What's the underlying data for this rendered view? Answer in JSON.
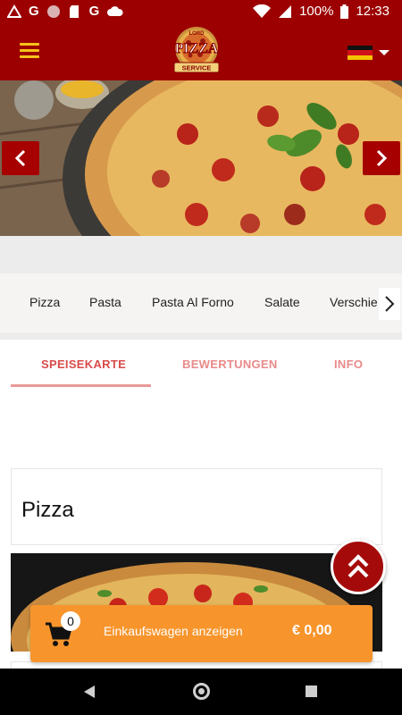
{
  "status_bar": {
    "left_glyphs": [
      "G",
      "G"
    ],
    "battery": "100%",
    "time": "12:33",
    "icons": [
      "alert-triangle-icon",
      "google-g-icon",
      "circle-dot-icon",
      "sd-card-icon",
      "google-g-icon",
      "cloud-icon",
      "wifi-icon",
      "signal-icon",
      "battery-icon"
    ]
  },
  "header": {
    "logo_text": {
      "top": "LORD",
      "main": "PIZZA",
      "bottom": "SERVICE"
    },
    "language": "de",
    "colors": {
      "bar": "#9c0000",
      "menu_icon": "#f5c21a"
    }
  },
  "categories": [
    "Pizza",
    "Pasta",
    "Pasta Al Forno",
    "Salate",
    "Verschie"
  ],
  "tabs": [
    {
      "label": "SPEISEKARTE",
      "active": true
    },
    {
      "label": "BEWERTUNGEN",
      "active": false
    },
    {
      "label": "INFO",
      "active": false
    }
  ],
  "section": {
    "title": "Pizza"
  },
  "cart": {
    "count": "0",
    "label": "Einkaufswagen anzeigen",
    "total": "€ 0,00",
    "color": "#f7952c"
  },
  "accent": "#a50a0a"
}
